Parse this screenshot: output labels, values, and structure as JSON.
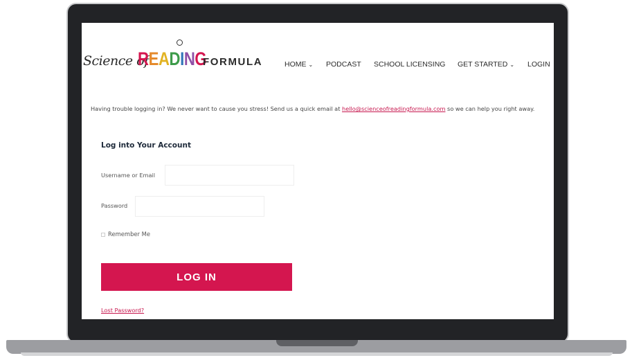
{
  "logo": {
    "script_text": "Science of",
    "reading_letters": [
      {
        "ch": "R",
        "color": "#d4164f"
      },
      {
        "ch": "E",
        "color": "#e58a2c"
      },
      {
        "ch": "A",
        "color": "#e2b323"
      },
      {
        "ch": "D",
        "color": "#3d9b4a"
      },
      {
        "ch": "I",
        "color": "#3276b9"
      },
      {
        "ch": "N",
        "color": "#8f4fa6"
      },
      {
        "ch": "G",
        "color": "#d4164f"
      }
    ],
    "formula_text": "FORMULA"
  },
  "nav": {
    "items": [
      {
        "label": "HOME",
        "has_dropdown": true
      },
      {
        "label": "PODCAST",
        "has_dropdown": false
      },
      {
        "label": "SCHOOL LICENSING",
        "has_dropdown": false
      },
      {
        "label": "GET STARTED",
        "has_dropdown": true
      },
      {
        "label": "LOGIN",
        "has_dropdown": false
      }
    ]
  },
  "notice": {
    "text_before": "Having trouble logging in? We never want to cause you stress! Send us a quick email at ",
    "email": "hello@scienceofreadingformula.com",
    "text_after": " so we can help you right away."
  },
  "login": {
    "title": "Log into Your Account",
    "username_label": "Username or Email",
    "username_value": "",
    "password_label": "Password",
    "password_value": "",
    "remember_label": "Remember Me",
    "submit_label": "LOG IN",
    "lost_password": "Lost Password?"
  },
  "colors": {
    "brand_pink": "#d4164f",
    "frame": "#222326"
  }
}
